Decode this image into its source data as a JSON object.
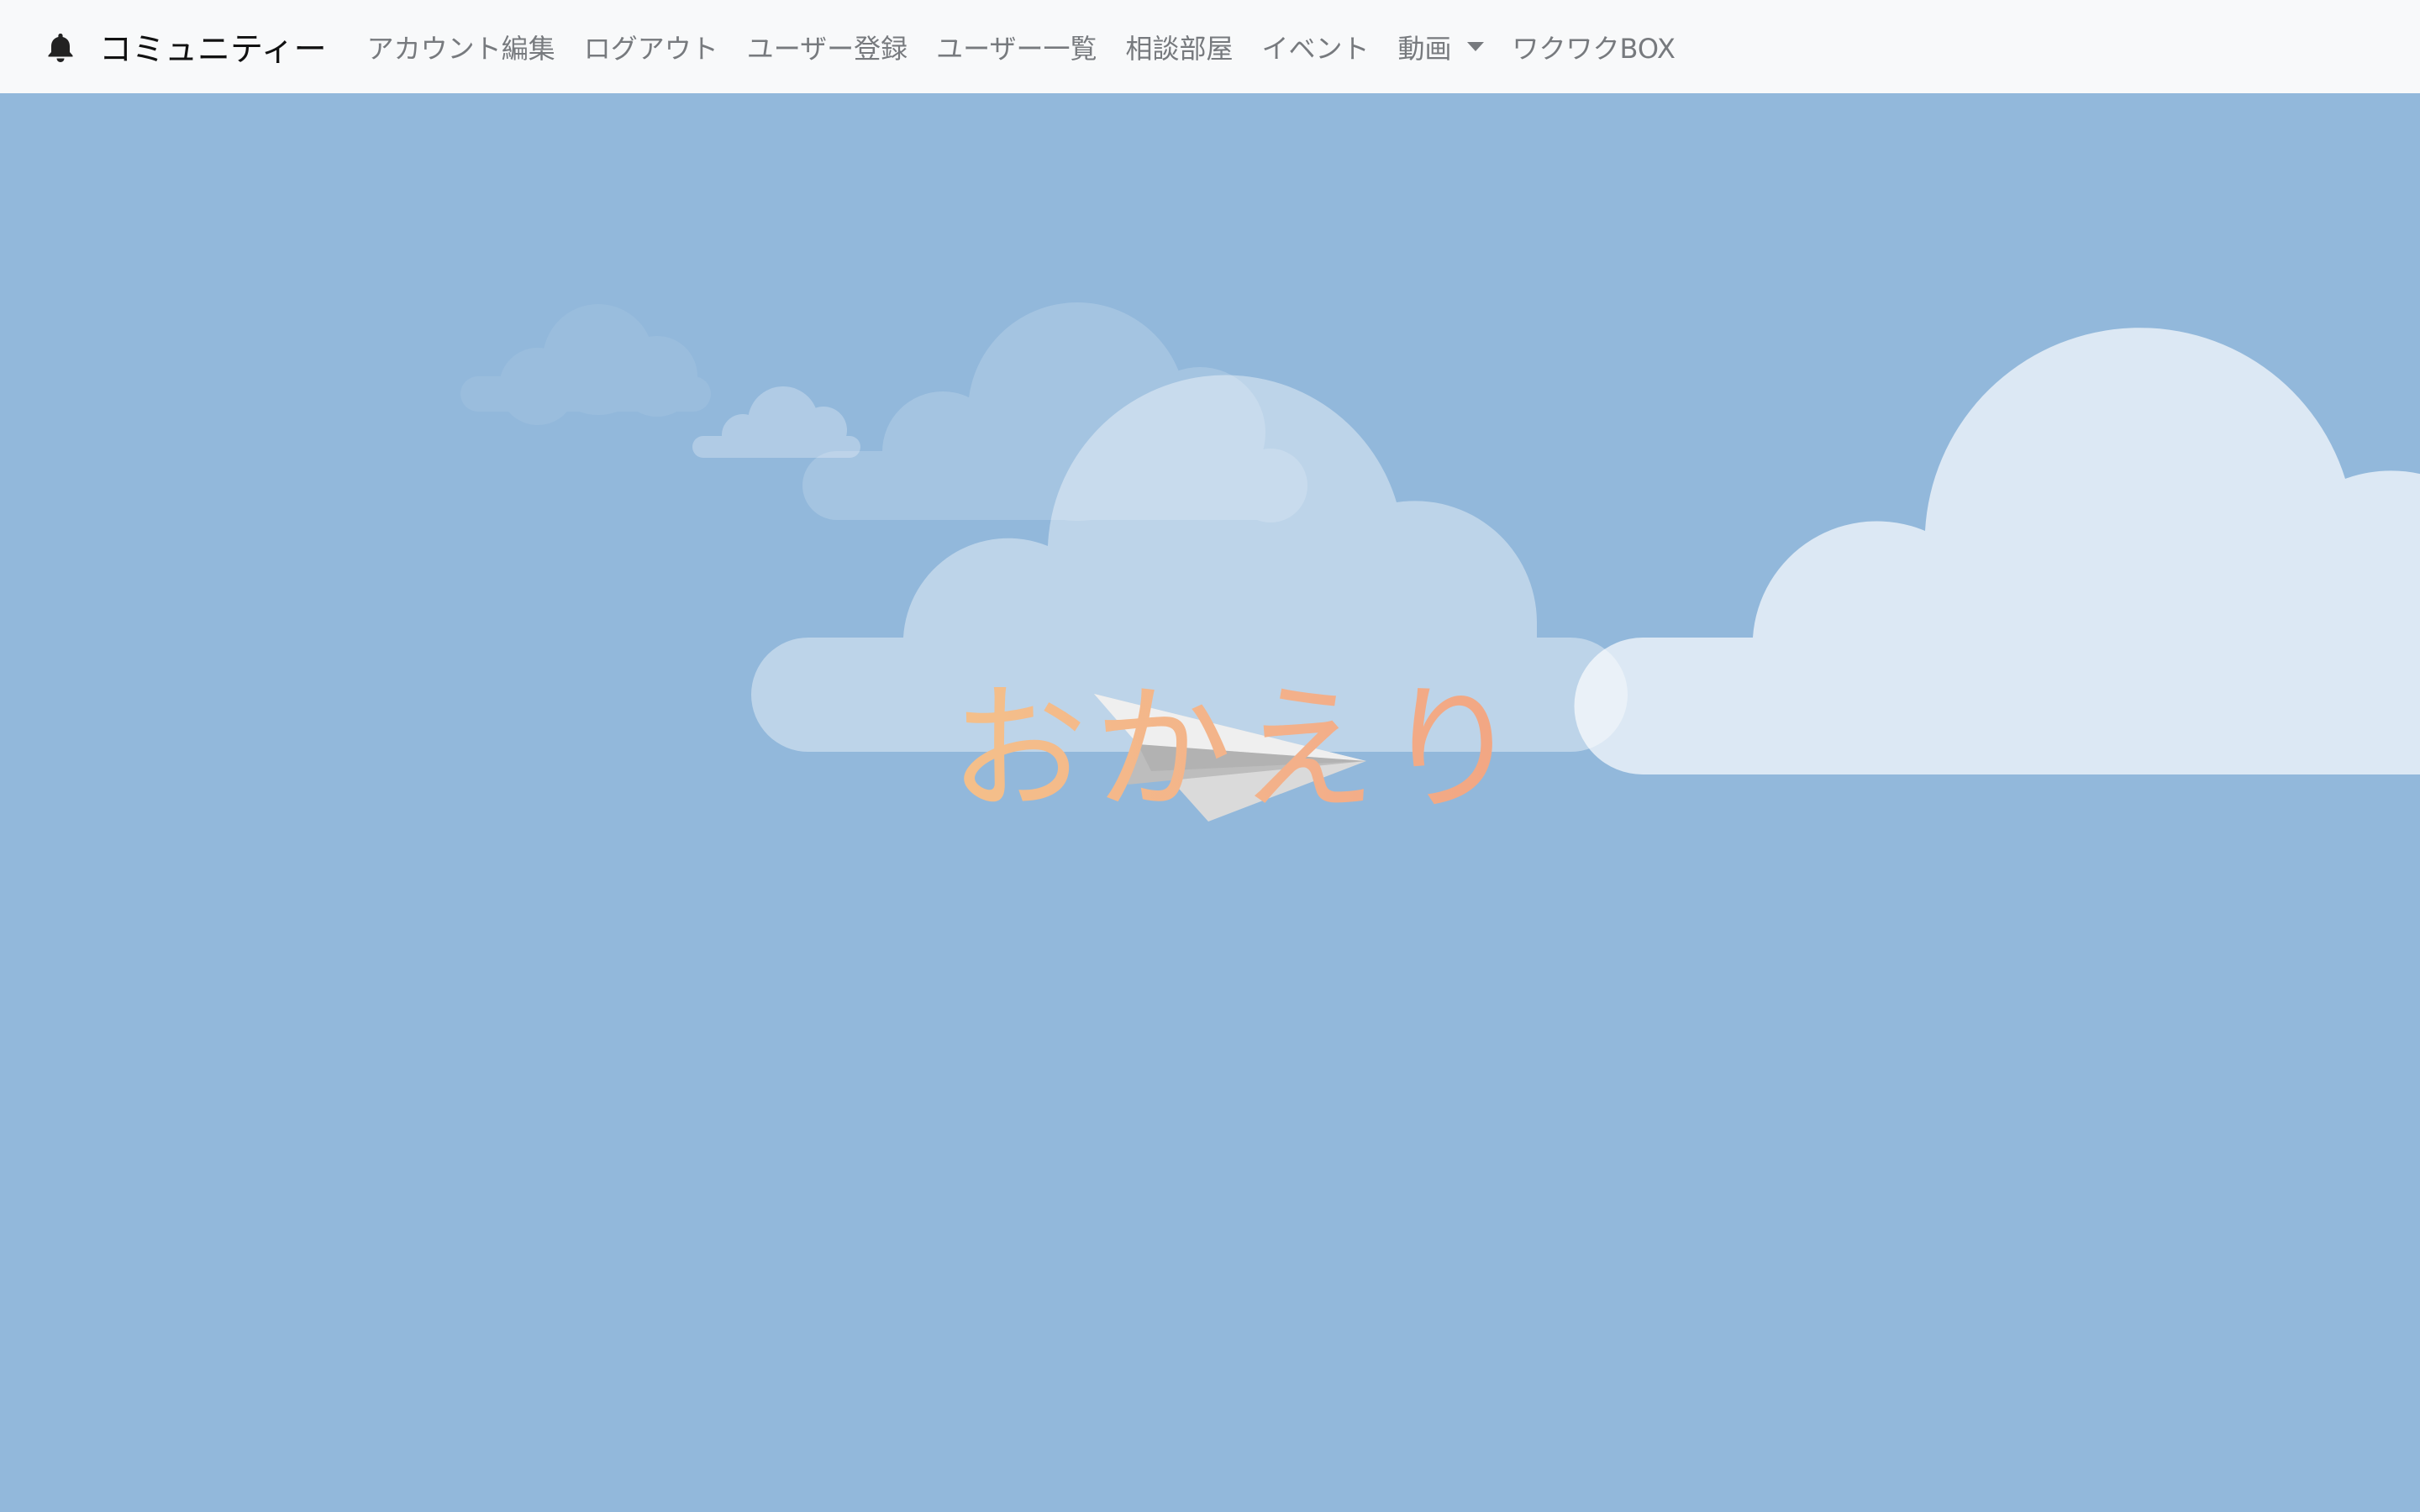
{
  "navbar": {
    "brand": {
      "icon": "bell-icon",
      "title": "コミュニティー"
    },
    "items": [
      {
        "label": "アカウント編集"
      },
      {
        "label": "ログアウト"
      },
      {
        "label": "ユーザー登録"
      },
      {
        "label": "ユーザー一覧"
      },
      {
        "label": "相談部屋"
      },
      {
        "label": "イベント"
      },
      {
        "label": "動画",
        "dropdown": true,
        "icon": "caret-down-icon"
      },
      {
        "label": "ワクワクBOX"
      }
    ]
  },
  "hero": {
    "welcome_text": "おかえり",
    "plane_icon": "paper-airplane-icon"
  },
  "colors": {
    "navbar_bg": "#f8f9fa",
    "sky": "#92b8db",
    "welcome_text_gradient": [
      "#f4c08a",
      "#f2a582"
    ]
  }
}
